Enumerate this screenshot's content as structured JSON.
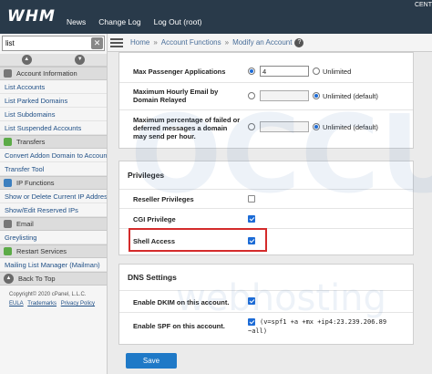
{
  "app": {
    "logo": "WHM",
    "nav": [
      "News",
      "Change Log",
      "Log Out (root)"
    ],
    "top_right": "CENT"
  },
  "sidebar": {
    "search_value": "list",
    "sections": [
      {
        "title": "Account Information",
        "icon": "account-info-icon",
        "items": [
          "List Accounts",
          "List Parked Domains",
          "List Subdomains",
          "List Suspended Accounts"
        ]
      },
      {
        "title": "Transfers",
        "icon": "transfers-icon",
        "items": [
          "Convert Addon Domain to Account",
          "Transfer Tool"
        ]
      },
      {
        "title": "IP Functions",
        "icon": "ip-functions-icon",
        "items": [
          "Show or Delete Current IP Addresses",
          "Show/Edit Reserved IPs"
        ]
      },
      {
        "title": "Email",
        "icon": "email-icon",
        "items": [
          "Greylisting"
        ]
      },
      {
        "title": "Restart Services",
        "icon": "restart-services-icon",
        "items": [
          "Mailing List Manager (Mailman)"
        ]
      }
    ],
    "back_to_top": "Back To Top",
    "copyright": "Copyright© 2020 cPanel, L.L.C.",
    "footer_links": [
      "EULA",
      "Trademarks",
      "Privacy Policy"
    ]
  },
  "breadcrumb": [
    "Home",
    "Account Functions",
    "Modify an Account"
  ],
  "limits": {
    "passenger_label": "Max Passenger Applications",
    "passenger_value": "4",
    "unlimited": "Unlimited",
    "hourly_email_label": "Maximum Hourly Email by Domain Relayed",
    "unlimited_default": "Unlimited (default)",
    "failed_pct_label": "Maximum percentage of failed or deferred messages a domain may send per hour."
  },
  "privileges": {
    "title": "Privileges",
    "reseller": "Reseller Privileges",
    "cgi": "CGI Privilege",
    "shell": "Shell Access"
  },
  "dns": {
    "title": "DNS Settings",
    "dkim": "Enable DKIM on this account.",
    "spf": "Enable SPF on this account.",
    "spf_record_line1": "(v=spf1 +a +mx +ip4:23.239.206.89",
    "spf_record_line2": "~all)"
  },
  "save_label": "Save",
  "watermark": {
    "top": "OCCU",
    "bottom": "webhosting"
  },
  "colors": {
    "topbar": "#293a4a",
    "accent": "#1c6bd6",
    "highlight": "#d42b2b",
    "save": "#1f79c7"
  }
}
